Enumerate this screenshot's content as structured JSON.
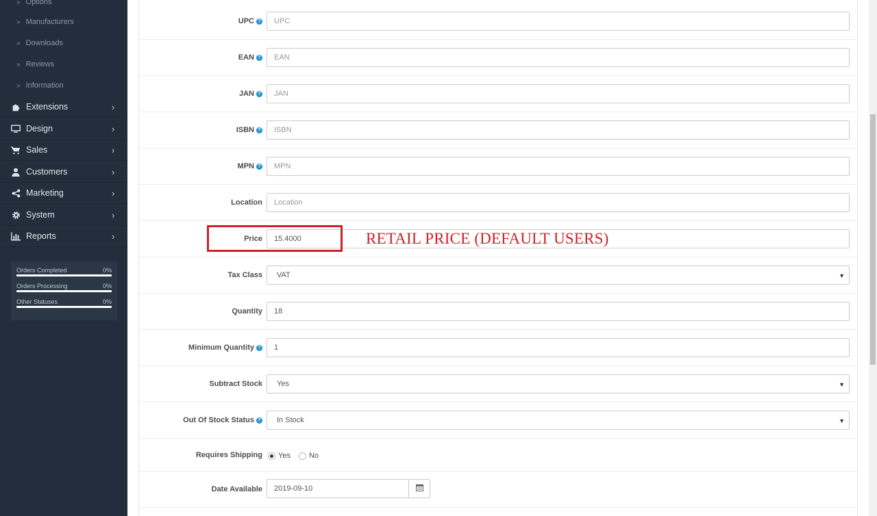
{
  "sidebar": {
    "sub_items": [
      {
        "label": "Options"
      },
      {
        "label": "Manufacturers"
      },
      {
        "label": "Downloads"
      },
      {
        "label": "Reviews"
      },
      {
        "label": "Information"
      }
    ],
    "menu": [
      {
        "label": "Extensions",
        "icon": "puzzle-icon"
      },
      {
        "label": "Design",
        "icon": "monitor-icon"
      },
      {
        "label": "Sales",
        "icon": "cart-icon"
      },
      {
        "label": "Customers",
        "icon": "user-icon"
      },
      {
        "label": "Marketing",
        "icon": "share-icon"
      },
      {
        "label": "System",
        "icon": "cog-icon"
      },
      {
        "label": "Reports",
        "icon": "bar-chart-icon"
      }
    ],
    "stats": [
      {
        "label": "Orders Completed",
        "value": "0%",
        "progress": 1.0
      },
      {
        "label": "Orders Processing",
        "value": "0%",
        "progress": 1.0
      },
      {
        "label": "Other Statuses",
        "value": "0%",
        "progress": 1.0
      }
    ]
  },
  "form": {
    "upc": {
      "label": "UPC",
      "placeholder": "UPC",
      "value": ""
    },
    "ean": {
      "label": "EAN",
      "placeholder": "EAN",
      "value": ""
    },
    "jan": {
      "label": "JAN",
      "placeholder": "JAN",
      "value": ""
    },
    "isbn": {
      "label": "ISBN",
      "placeholder": "ISBN",
      "value": ""
    },
    "mpn": {
      "label": "MPN",
      "placeholder": "MPN",
      "value": ""
    },
    "location": {
      "label": "Location",
      "placeholder": "Location",
      "value": ""
    },
    "price": {
      "label": "Price",
      "value": "15.4000"
    },
    "tax_class": {
      "label": "Tax Class",
      "value": "VAT"
    },
    "quantity": {
      "label": "Quantity",
      "value": "18"
    },
    "minimum_quantity": {
      "label": "Minimum Quantity",
      "value": "1"
    },
    "subtract_stock": {
      "label": "Subtract Stock",
      "value": "Yes"
    },
    "out_of_stock_status": {
      "label": "Out Of Stock Status",
      "value": "In Stock"
    },
    "requires_shipping": {
      "label": "Requires Shipping",
      "options": [
        "Yes",
        "No"
      ],
      "selected": "Yes"
    },
    "date_available": {
      "label": "Date Available",
      "value": "2019-09-10"
    }
  },
  "annotation": {
    "text": "RETAIL PRICE (DEFAULT USERS)",
    "color": "#d11f26"
  },
  "colors": {
    "sidebar_bg": "#232e3c",
    "help_icon": "#1e91cf"
  }
}
